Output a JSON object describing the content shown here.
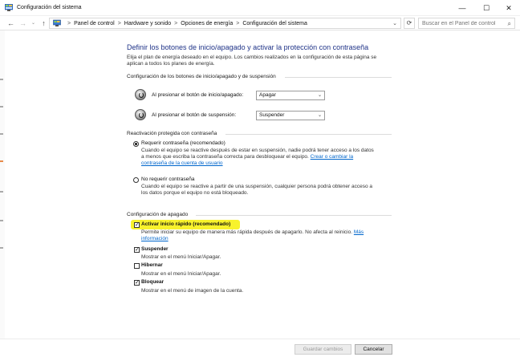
{
  "window": {
    "title": "Configuración del sistema",
    "minimize_glyph": "—",
    "maximize_glyph": "☐",
    "close_glyph": "✕"
  },
  "nav": {
    "back_glyph": "←",
    "forward_glyph": "→",
    "history_glyph": "⌄",
    "up_glyph": "↑",
    "refresh_glyph": "⟳",
    "dropdown_glyph": "⌄"
  },
  "breadcrumb": {
    "separator": ">",
    "items": [
      "Panel de control",
      "Hardware y sonido",
      "Opciones de energía",
      "Configuración del sistema"
    ]
  },
  "search": {
    "placeholder": "Buscar en el Panel de control",
    "icon_glyph": "⌕"
  },
  "page": {
    "heading": "Definir los botones de inicio/apagado y activar la protección con contraseña",
    "intro_line1": "Elija el plan de energía deseado en el equipo. Los cambios realizados en la configuración de esta página se",
    "intro_line2": "aplican a todos los planes de energía."
  },
  "power_buttons": {
    "section_title": "Configuración de los botones de inicio/apagado y de suspensión",
    "power_label": "Al presionar el botón de inicio/apagado:",
    "power_value": "Apagar",
    "sleep_label": "Al presionar el botón de suspensión:",
    "sleep_value": "Suspender",
    "caret_glyph": "⌄"
  },
  "password": {
    "section_title": "Reactivación protegida con contraseña",
    "require_label": "Requerir contraseña (recomendado)",
    "require_selected": true,
    "require_desc_line1": "Cuando el equipo se reactive después de estar en suspensión, nadie podrá tener acceso a los datos",
    "require_desc_line2": "a menos que escriba la contraseña correcta para desbloquear el equipo.",
    "require_link_part1": "Crear o cambiar la",
    "require_link_part2": "contraseña de la cuenta de usuario",
    "norequire_label": "No requerir contraseña",
    "norequire_selected": false,
    "norequire_desc_line1": "Cuando el equipo se reactive a partir de una suspensión, cualquier persona podrá obtener acceso a",
    "norequire_desc_line2": "los datos porque el equipo no está bloqueado."
  },
  "shutdown": {
    "section_title": "Configuración de apagado",
    "fast_label": "Activar inicio rápido (recomendado)",
    "fast_checked": true,
    "fast_desc": "Permite iniciar su equipo de manera más rápida después de apagarlo. No afecta al reinicio.",
    "fast_link_part1": "Más",
    "fast_link_part2": "información",
    "suspend_label": "Suspender",
    "suspend_checked": true,
    "suspend_desc": "Mostrar en el menú Iniciar/Apagar.",
    "hibernate_label": "Hibernar",
    "hibernate_checked": false,
    "hibernate_desc": "Mostrar en el menú Iniciar/Apagar.",
    "lock_label": "Bloquear",
    "lock_checked": true,
    "lock_desc": "Mostrar en el menú de imagen de la cuenta.",
    "check_glyph": "✓",
    "highlight_color": "#f8f22c"
  },
  "footer": {
    "save_label": "Guardar cambios",
    "save_enabled": false,
    "cancel_label": "Cancelar"
  },
  "colors": {
    "heading": "#1e3287",
    "link": "#0066cc"
  }
}
